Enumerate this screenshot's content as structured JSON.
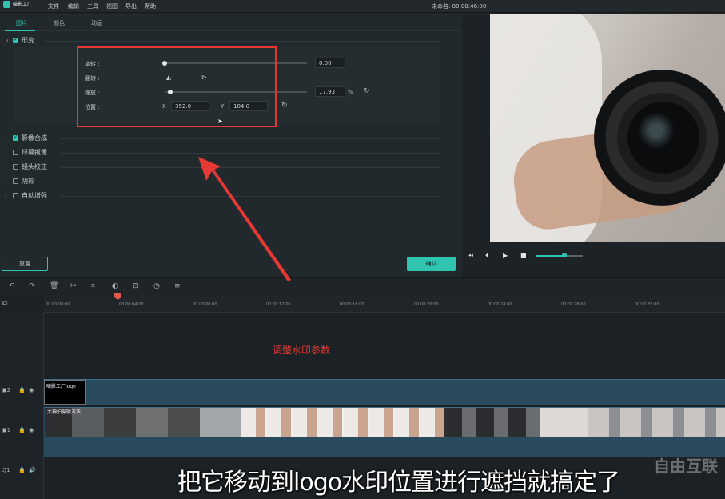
{
  "app": {
    "logo_text": "喵影工厂",
    "project_title": "未命名: 00:00:46:00"
  },
  "menu": [
    "文件",
    "编辑",
    "工具",
    "视图",
    "导出",
    "帮助"
  ],
  "tabs": [
    {
      "label": "图片",
      "active": true
    },
    {
      "label": "颜色",
      "active": false
    },
    {
      "label": "动画",
      "active": false
    }
  ],
  "sections": [
    {
      "label": "形变",
      "checked": true,
      "expanded": true
    },
    {
      "label": "影像合成",
      "checked": true,
      "expanded": false
    },
    {
      "label": "绿幕抠像",
      "checked": false,
      "expanded": false
    },
    {
      "label": "镜头校正",
      "checked": false,
      "expanded": false
    },
    {
      "label": "阴影",
      "checked": false,
      "expanded": false
    },
    {
      "label": "自动增强",
      "checked": false,
      "expanded": false
    }
  ],
  "transform": {
    "rotate_label": "旋转 :",
    "rotate_value": "0.00",
    "rotate_fraction": 0.0,
    "flip_label": "翻转 :",
    "scale_label": "缩放 :",
    "scale_value": "17.93",
    "scale_unit": "%",
    "scale_fraction": 0.04,
    "position_label": "位置 :",
    "x_label": "X",
    "x_value": "352.0",
    "y_label": "Y",
    "y_value": "184.0"
  },
  "buttons": {
    "reset": "重置",
    "ok": "确认"
  },
  "ruler_ticks": [
    "00:00:00:00",
    "00:00:04:00",
    "00:00:08:00",
    "00:00:12:00",
    "00:00:16:00",
    "00:00:20:00",
    "00:00:24:00",
    "00:00:28:00",
    "00:00:32:00"
  ],
  "tracks": {
    "track2_label": "2",
    "track1_label": "1",
    "audio_label": "1",
    "logo_clip_label": "喵影工厂logo",
    "video_clip_label": "大神拍摄微方法"
  },
  "annotation": "调整水印参数",
  "subtitle": "把它移动到logo水印位置进行遮挡就搞定了",
  "watermark": "自由互联",
  "colors": {
    "accent": "#2ec4b0",
    "annotation_red": "#e53935",
    "playhead": "#e2574c"
  }
}
